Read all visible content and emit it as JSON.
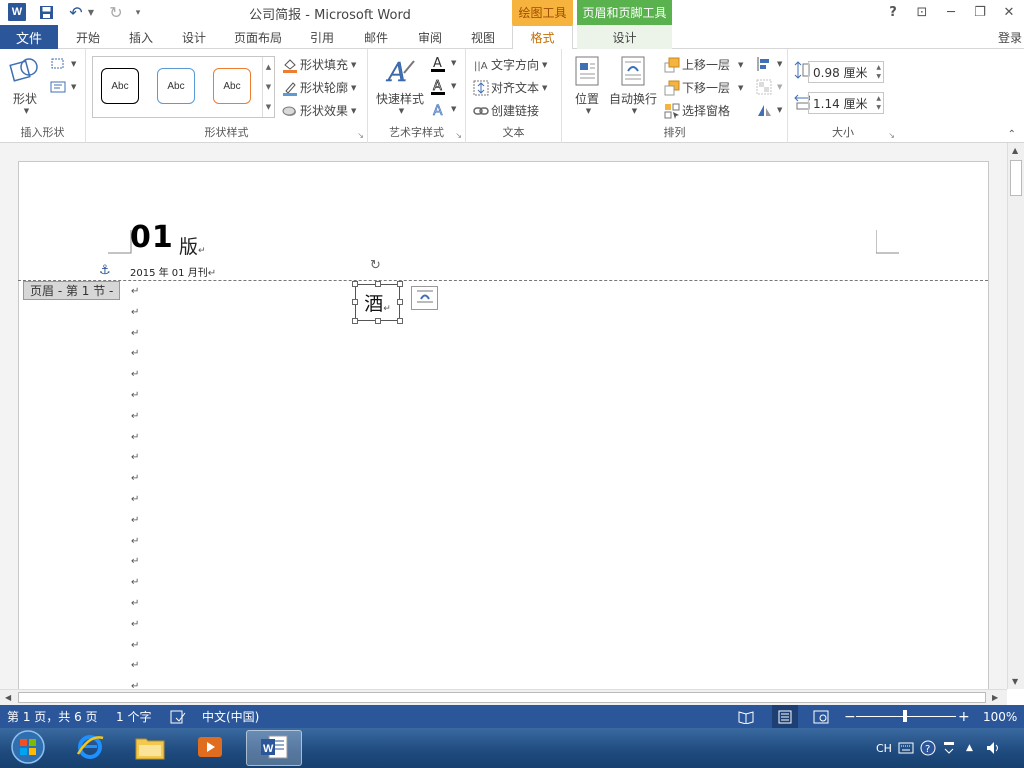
{
  "titlebar": {
    "app_icon_letter": "W",
    "title": "公司简报 - Microsoft Word",
    "context_drawing": "绘图工具",
    "context_header_footer": "页眉和页脚工具",
    "help": "?",
    "restore_ribbon": "⊡",
    "minimize": "─",
    "maximize": "❐",
    "close": "✕"
  },
  "tabs": {
    "file": "文件",
    "home": "开始",
    "insert": "插入",
    "design": "设计",
    "layout": "页面布局",
    "references": "引用",
    "mailings": "邮件",
    "review": "审阅",
    "view": "视图",
    "format": "格式",
    "hf_design": "设计",
    "login": "登录"
  },
  "ribbon": {
    "insert_shapes": {
      "shapes_label": "形状",
      "group_label": "插入形状"
    },
    "shape_styles": {
      "style_sample": "Abc",
      "fill": "形状填充",
      "outline": "形状轮廓",
      "effects": "形状效果",
      "group_label": "形状样式"
    },
    "wordart": {
      "quick_styles": "快速样式",
      "group_label": "艺术字样式"
    },
    "text": {
      "direction": "文字方向",
      "align": "对齐文本",
      "link": "创建链接",
      "group_label": "文本"
    },
    "arrange": {
      "position": "位置",
      "wrap": "自动换行",
      "bring_forward": "上移一层",
      "send_backward": "下移一层",
      "selection_pane": "选择窗格",
      "group_label": "排列"
    },
    "size": {
      "height": "0.98 厘米",
      "width": "1.14 厘米",
      "group_label": "大小"
    }
  },
  "document": {
    "edition_number": "01",
    "edition_char": "版",
    "date_line": "2015 年 01 月刊",
    "header_label": "页眉 - 第 1 节 -",
    "shape_text": "酒",
    "paragraph_mark": "↵"
  },
  "statusbar": {
    "page": "第 1 页，共 6 页",
    "words": "1 个字",
    "language": "中文(中国)",
    "zoom": "100%"
  },
  "taskbar": {
    "ime": "CH"
  },
  "colors": {
    "word_blue": "#2b579a",
    "drawing_tools": "#f6b33d",
    "header_footer_tools": "#59b24d"
  }
}
